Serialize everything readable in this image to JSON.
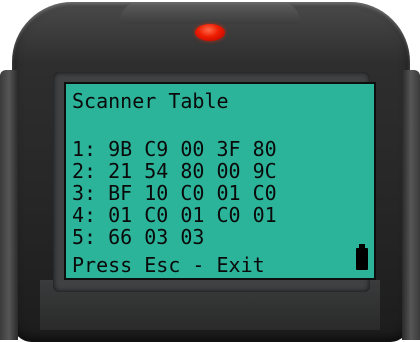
{
  "screen": {
    "title": "Scanner Table",
    "rows": [
      "1: 9B C9 00 3F 80",
      "2: 21 54 80 00 9C",
      "3: BF 10 C0 01 C0",
      "4: 01 C0 01 C0 01",
      "5: 66 03 03"
    ],
    "footer": "Press Esc - Exit",
    "battery_icon": "battery-icon"
  },
  "colors": {
    "screen": "#2bb49a",
    "device": "#2a2a2a",
    "led": "#ee1c00"
  }
}
